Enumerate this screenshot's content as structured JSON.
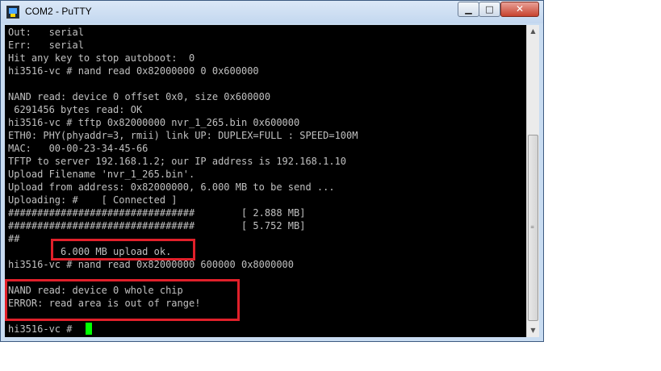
{
  "window": {
    "title": "COM2 - PuTTY",
    "minimize_glyph": "▁",
    "maximize_glyph": "□",
    "close_glyph": "✕"
  },
  "terminal": {
    "lines": [
      "Out:   serial",
      "Err:   serial",
      "Hit any key to stop autoboot:  0",
      "hi3516-vc # nand read 0x82000000 0 0x600000",
      "",
      "NAND read: device 0 offset 0x0, size 0x600000",
      " 6291456 bytes read: OK",
      "hi3516-vc # tftp 0x82000000 nvr_1_265.bin 0x600000",
      "ETH0: PHY(phyaddr=3, rmii) link UP: DUPLEX=FULL : SPEED=100M",
      "MAC:   00-00-23-34-45-66",
      "TFTP to server 192.168.1.2; our IP address is 192.168.1.10",
      "Upload Filename 'nvr_1_265.bin'.",
      "Upload from address: 0x82000000, 6.000 MB to be send ...",
      "Uploading: #    [ Connected ]",
      "################################        [ 2.888 MB]",
      "################################        [ 5.752 MB]",
      "##",
      "         6.000 MB upload ok.",
      "hi3516-vc # nand read 0x82000000 600000 0x8000000",
      "",
      "NAND read: device 0 whole chip",
      "ERROR: read area is out of range!",
      "",
      "hi3516-vc # "
    ],
    "text_color": "#c0c0c0",
    "background": "#000000",
    "cursor_color": "#00ff00"
  },
  "scrollbar": {
    "up_glyph": "▲",
    "down_glyph": "▼",
    "grip_glyph": "≡"
  },
  "highlight_color": "#e0202a"
}
